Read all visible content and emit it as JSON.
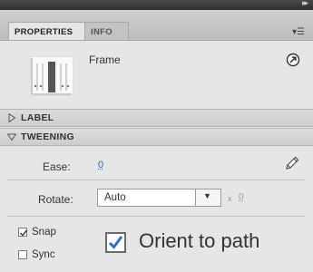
{
  "panel": {
    "tabs": [
      {
        "label": "PROPERTIES",
        "active": true
      },
      {
        "label": "INFO",
        "active": false
      }
    ],
    "collapse_icon": "double-chevron-right-icon",
    "menu_icon": "panel-menu-icon"
  },
  "instance": {
    "type_label": "Frame",
    "thumbnail_icon": "frame-instance-icon",
    "swap_icon": "swap-icon"
  },
  "sections": {
    "label": {
      "title": "LABEL",
      "expanded": false
    },
    "tweening": {
      "title": "TWEENING",
      "expanded": true
    }
  },
  "tweening": {
    "ease_label": "Ease:",
    "ease_value": "0",
    "rotate_label": "Rotate:",
    "rotate_value": "Auto",
    "times_symbol": "x",
    "rotate_count": "0",
    "checkboxes": [
      {
        "label": "Snap",
        "checked": true
      },
      {
        "label": "Sync",
        "checked": false
      }
    ],
    "orient": {
      "label": "Orient to path",
      "checked": true
    }
  },
  "colors": {
    "panel_bg": "#e6e6e6",
    "link_blue": "#2a5fbf",
    "check_blue": "#2d6fc4"
  }
}
